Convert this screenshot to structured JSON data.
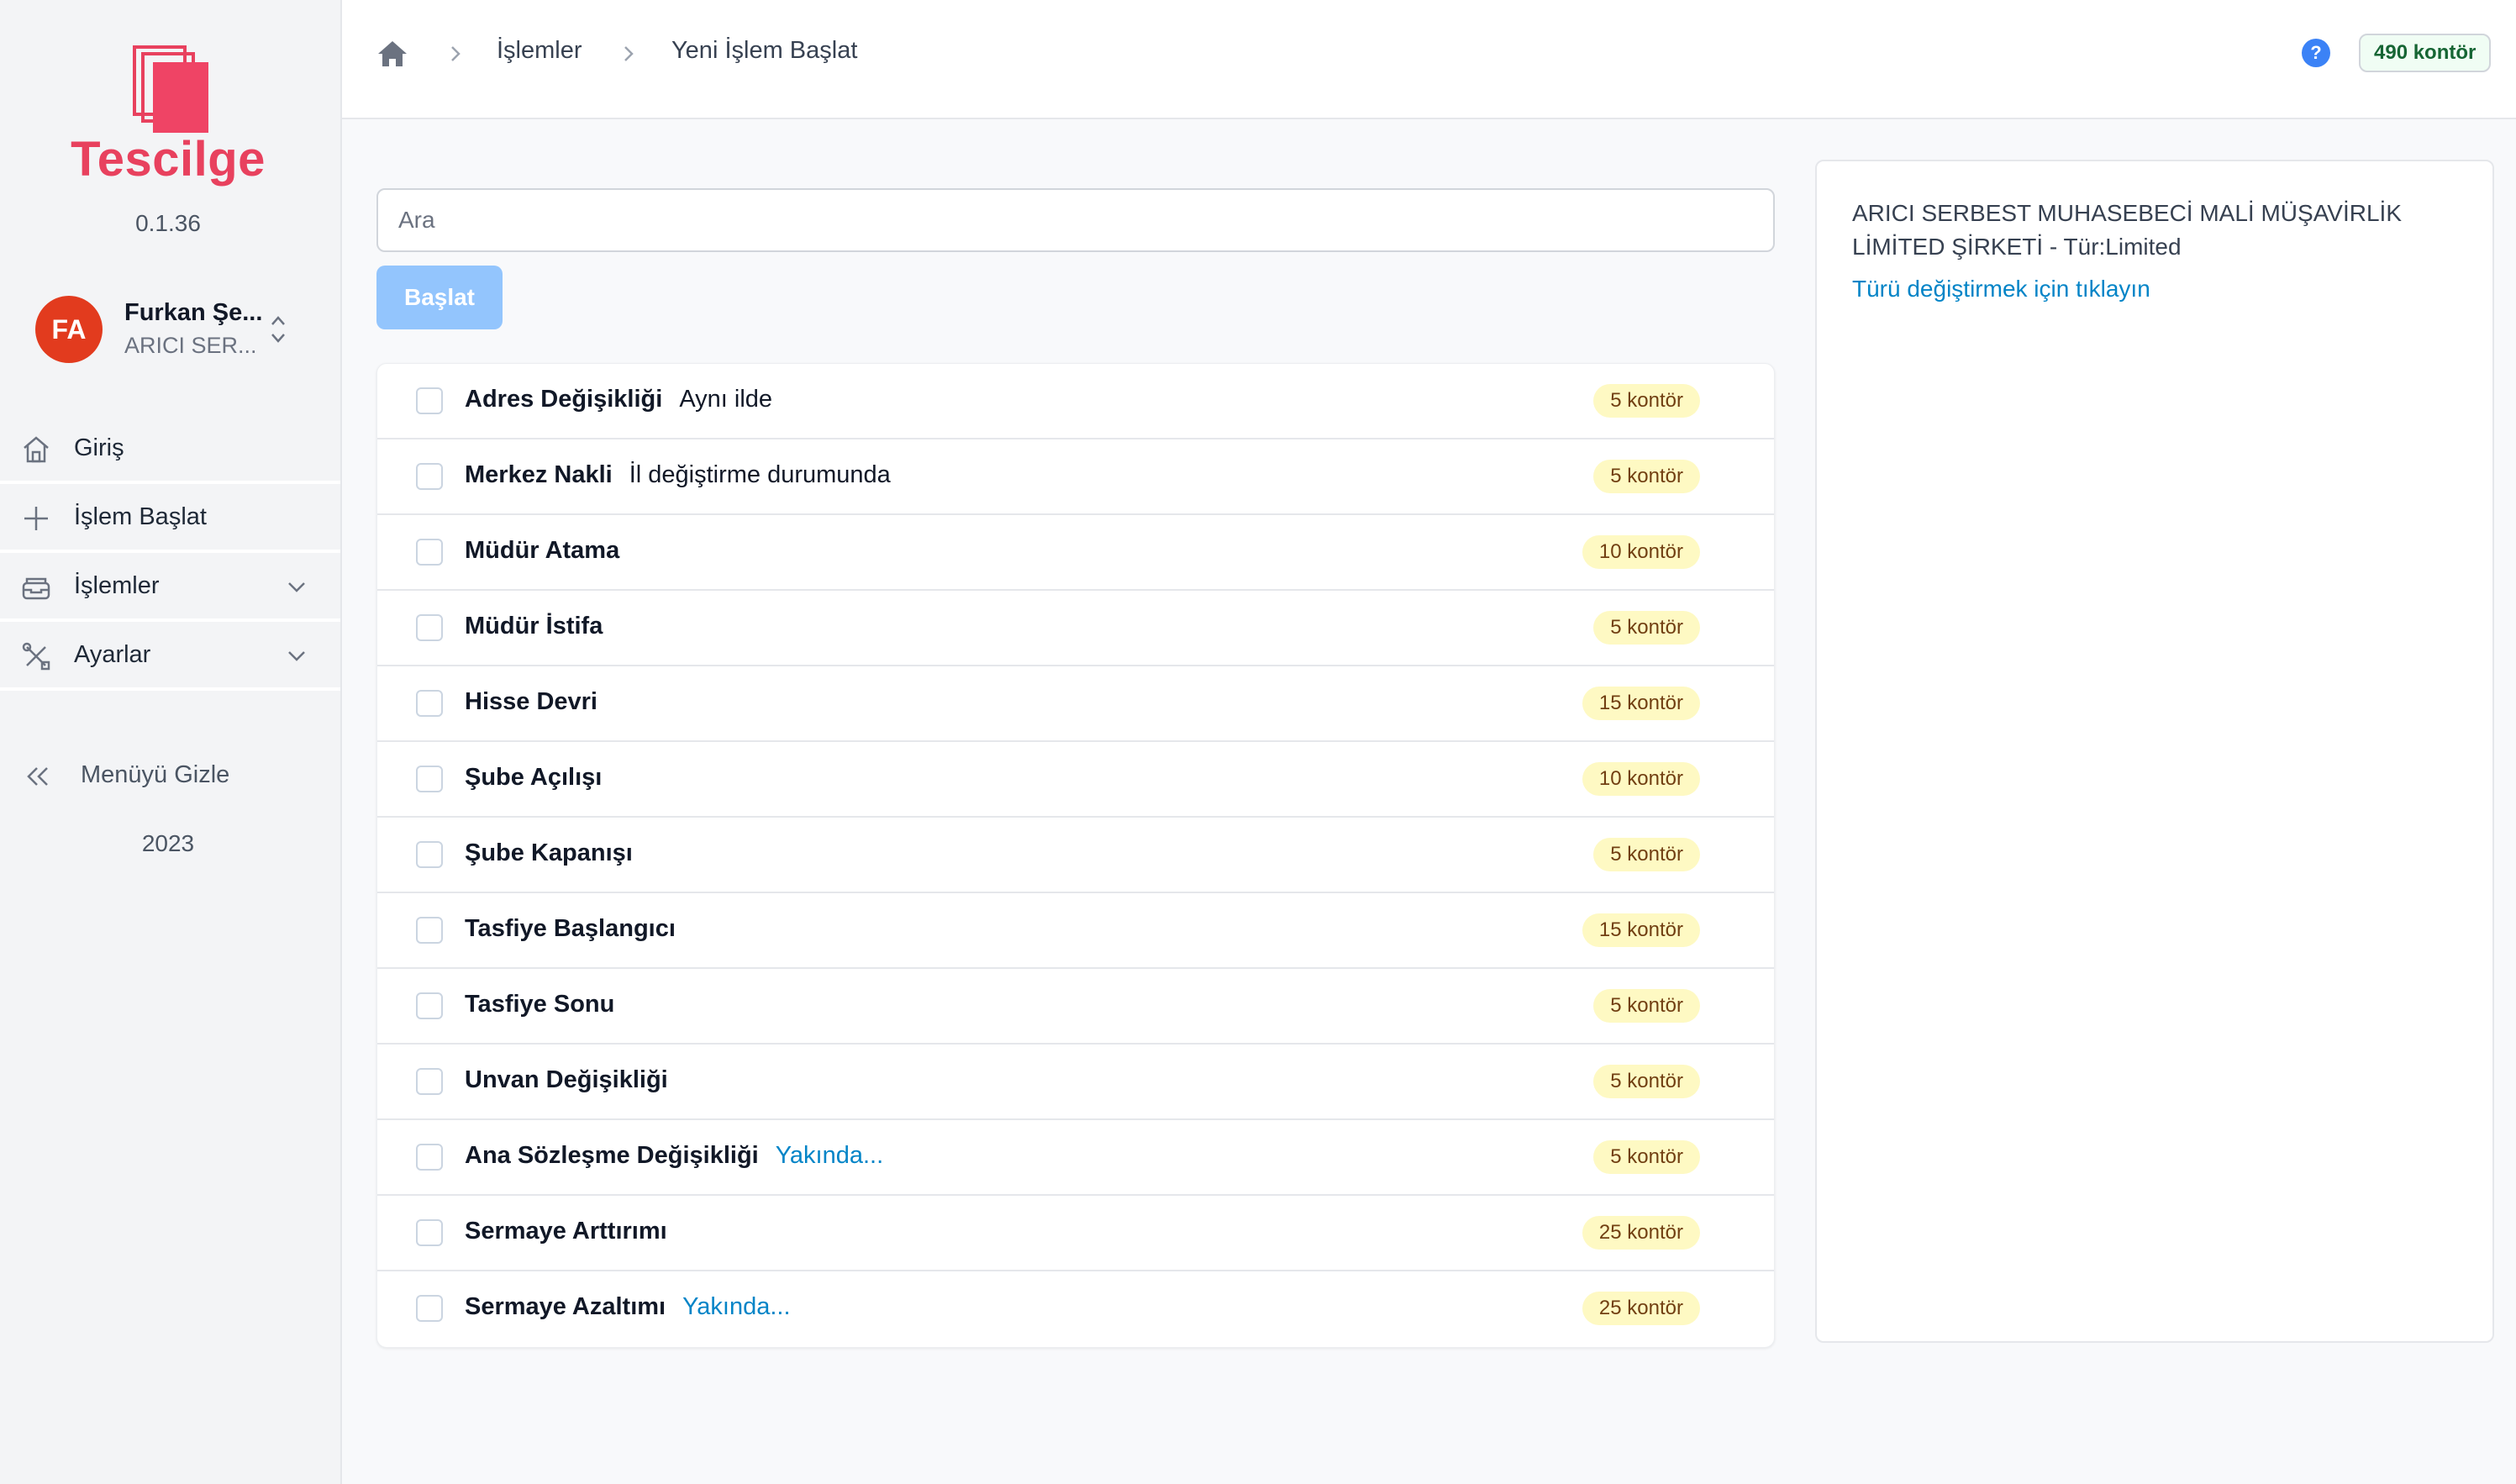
{
  "app": {
    "brand": "Tescilge",
    "version": "0.1.36",
    "year": "2023",
    "accent": "#e8415e"
  },
  "user": {
    "initials": "FA",
    "name": "Furkan Şe...",
    "company": "ARICI SER..."
  },
  "sidebar": {
    "items": [
      {
        "label": "Giriş",
        "icon": "home-icon"
      },
      {
        "label": "İşlem Başlat",
        "icon": "plus-icon"
      },
      {
        "label": "İşlemler",
        "icon": "inbox-icon",
        "expandable": true
      },
      {
        "label": "Ayarlar",
        "icon": "tools-icon",
        "expandable": true
      }
    ],
    "hide_menu": "Menüyü Gizle"
  },
  "header": {
    "breadcrumb": [
      "İşlemler",
      "Yeni İşlem Başlat"
    ],
    "credits": "490 kontör",
    "help": "?"
  },
  "main": {
    "search_placeholder": "Ara",
    "start_button": "Başlat",
    "operations": [
      {
        "name": "Adres Değişikliği",
        "note": "Aynı ilde",
        "note_type": "plain",
        "cost": "5 kontör"
      },
      {
        "name": "Merkez Nakli",
        "note": "İl değiştirme durumunda",
        "note_type": "plain",
        "cost": "5 kontör"
      },
      {
        "name": "Müdür Atama",
        "note": "",
        "note_type": "",
        "cost": "10 kontör"
      },
      {
        "name": "Müdür İstifa",
        "note": "",
        "note_type": "",
        "cost": "5 kontör"
      },
      {
        "name": "Hisse Devri",
        "note": "",
        "note_type": "",
        "cost": "15 kontör"
      },
      {
        "name": "Şube Açılışı",
        "note": "",
        "note_type": "",
        "cost": "10 kontör"
      },
      {
        "name": "Şube Kapanışı",
        "note": "",
        "note_type": "",
        "cost": "5 kontör"
      },
      {
        "name": "Tasfiye Başlangıcı",
        "note": "",
        "note_type": "",
        "cost": "15 kontör"
      },
      {
        "name": "Tasfiye Sonu",
        "note": "",
        "note_type": "",
        "cost": "5 kontör"
      },
      {
        "name": "Unvan Değişikliği",
        "note": "",
        "note_type": "",
        "cost": "5 kontör"
      },
      {
        "name": "Ana Sözleşme Değişikliği",
        "note": "Yakında...",
        "note_type": "soon",
        "cost": "5 kontör"
      },
      {
        "name": "Sermaye Arttırımı",
        "note": "",
        "note_type": "",
        "cost": "25 kontör"
      },
      {
        "name": "Sermaye Azaltımı",
        "note": "Yakında...",
        "note_type": "soon",
        "cost": "25 kontör"
      }
    ]
  },
  "panel": {
    "company": "ARICI SERBEST MUHASEBECİ MALİ MÜŞAVİRLİK LİMİTED ŞİRKETİ - Tür:Limited",
    "change_type_link": "Türü değiştirmek için tıklayın"
  }
}
